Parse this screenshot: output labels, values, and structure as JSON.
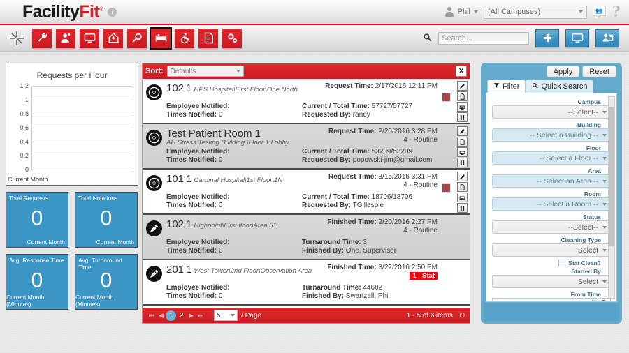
{
  "header": {
    "logo_part1": "Facility",
    "logo_part2": "Fit",
    "logo_tm": "®",
    "info_icon": "info-icon",
    "user_name": "Phil",
    "campus_value": "(All Campuses)",
    "chat_icon": "chat-users-icon",
    "help_icon": "question-mark-icon"
  },
  "toolbar": {
    "sparkle_icon": "sparkle-icon",
    "icons": [
      {
        "name": "wrench-icon",
        "label": "Maintenance"
      },
      {
        "name": "person-icon",
        "label": "Staff"
      },
      {
        "name": "monitor-icon",
        "label": "Display"
      },
      {
        "name": "home-icon",
        "label": "Home"
      },
      {
        "name": "magnifier-icon",
        "label": "Search"
      },
      {
        "name": "bed-icon",
        "label": "Beds",
        "active": true
      },
      {
        "name": "wheelchair-icon",
        "label": "Transport"
      },
      {
        "name": "document-icon",
        "label": "Reports"
      },
      {
        "name": "gears-icon",
        "label": "Settings"
      }
    ],
    "search_placeholder": "Search...",
    "add_icon": "plus-icon",
    "monitor_btn_icon": "monitor-icon",
    "user_btn_icon": "user-card-icon"
  },
  "chart_data": {
    "type": "bar",
    "title": "Requests per Hour",
    "categories": [],
    "values": [],
    "xlabel": "Current Month",
    "ylabel": "",
    "ylim": [
      0,
      1.2
    ],
    "yticks": [
      "1.2",
      "1",
      "0.8",
      "0.6",
      "0.4",
      "0.2",
      "0"
    ],
    "grid": true,
    "legend": "none",
    "note": "empty plot - no data series rendered"
  },
  "tiles": [
    {
      "title": "Total Requests",
      "value": "0",
      "footer": "Current Month"
    },
    {
      "title": "Total Isolations",
      "value": "0",
      "footer": "Current Month"
    },
    {
      "title": "Avg. Response Time",
      "value": "0",
      "footer": "Current Month (Minutes)"
    },
    {
      "title": "Avg. Turnaround Time",
      "value": "0",
      "footer": "Current Month (Minutes)"
    }
  ],
  "list": {
    "sort_label": "Sort:",
    "sort_value": "Defaults",
    "export_icon": "export-excel-icon",
    "labels": {
      "employee_notified": "Employee Notified:",
      "times_notified": "Times Notified:",
      "request_time": "Request Time:",
      "finished_time": "Finished Time:",
      "current_total_time": "Current / Total Time:",
      "requested_by": "Requested By:",
      "turnaround_time": "Turnaround Time:",
      "finished_by": "Finished By:"
    },
    "actions": [
      "edit-pencil-icon",
      "copy-page-icon",
      "print-icon",
      "pause-icon"
    ],
    "rows": [
      {
        "icon": "radiation-icon",
        "room": "102",
        "bed": "1",
        "location": "HPS Hospital\\First Floor\\One North",
        "big_title": false,
        "time_label": "Request Time:",
        "time_value": "2/17/2016 12:11 PM",
        "priority": "",
        "has_swatch": true,
        "stat": false,
        "employee_notified": "",
        "times_notified": "0",
        "metric_label": "Current / Total Time:",
        "metric_value": "57727/57727",
        "person_label": "Requested By:",
        "person_value": "randy",
        "shaded": false
      },
      {
        "icon": "radiation-icon",
        "room": "Test Patient Room 1",
        "bed": "",
        "location": "AH Stress Testing Building \\Floor 1\\Lobby",
        "big_title": true,
        "time_label": "Request Time:",
        "time_value": "2/20/2016 3:28 PM",
        "priority": "4 - Routine",
        "has_swatch": false,
        "stat": false,
        "employee_notified": "",
        "times_notified": "0",
        "metric_label": "Current / Total Time:",
        "metric_value": "53209/53209",
        "person_label": "Requested By:",
        "person_value": "popowski-jim@gmail.com",
        "shaded": true
      },
      {
        "icon": "radiation-icon",
        "room": "101",
        "bed": "1",
        "location": "Cardinal Hospital\\1st Floor\\1N",
        "big_title": false,
        "time_label": "Request Time:",
        "time_value": "3/15/2016 3:31 PM",
        "priority": "4 - Routine",
        "has_swatch": true,
        "stat": false,
        "employee_notified": "",
        "times_notified": "0",
        "metric_label": "Current / Total Time:",
        "metric_value": "18706/18706",
        "person_label": "Requested By:",
        "person_value": "TGillespie",
        "shaded": false
      },
      {
        "icon": "cleaning-brush-icon",
        "room": "102",
        "bed": "1",
        "location": "Highpoint\\First floor\\Area 51",
        "big_title": false,
        "time_label": "Finished Time:",
        "time_value": "2/20/2016 2:27 PM",
        "priority": "4 - Routine",
        "has_swatch": false,
        "stat": false,
        "employee_notified": "",
        "times_notified": "0",
        "metric_label": "Turnaround Time:",
        "metric_value": "3",
        "person_label": "Finished By:",
        "person_value": "One, Supervisor",
        "shaded": true
      },
      {
        "icon": "cleaning-brush-icon",
        "room": "201",
        "bed": "1",
        "location": "West Tower\\2nd Floor\\Observation Area",
        "big_title": false,
        "time_label": "Finished Time:",
        "time_value": "3/22/2016 2:50 PM",
        "priority": "1 - Stat",
        "has_swatch": false,
        "stat": true,
        "employee_notified": "",
        "times_notified": "0",
        "metric_label": "Turnaround Time:",
        "metric_value": "44602",
        "person_label": "Finished By:",
        "person_value": "Swartzell, Phil",
        "shaded": false
      }
    ],
    "footer": {
      "first_icon": "first-page-icon",
      "prev_icon": "prev-page-icon",
      "pages": [
        "1",
        "2"
      ],
      "current_page": "1",
      "next_icon": "next-page-icon",
      "last_icon": "last-page-icon",
      "page_size": "5",
      "per_page_label": "/ Page",
      "items_text": "1 - 5 of 6 items",
      "refresh_icon": "refresh-icon"
    }
  },
  "filter": {
    "apply_label": "Apply",
    "reset_label": "Reset",
    "tabs": [
      {
        "label": "Filter",
        "icon": "funnel-icon",
        "active": true
      },
      {
        "label": "Quick Search",
        "icon": "magnifier-icon",
        "active": false
      }
    ],
    "fields": [
      {
        "label": "Campus",
        "value": "--Select--",
        "style": "gray"
      },
      {
        "label": "Building",
        "value": "-- Select a Building --",
        "style": "blue"
      },
      {
        "label": "Floor",
        "value": "-- Select a Floor --",
        "style": "blue"
      },
      {
        "label": "Area",
        "value": "-- Select an Area --",
        "style": "blue"
      },
      {
        "label": "Room",
        "value": "-- Select a Room --",
        "style": "blue"
      },
      {
        "label": "Status",
        "value": "--Select--",
        "style": "gray"
      },
      {
        "label": "Cleaning Type",
        "value": "Select",
        "style": "gray"
      }
    ],
    "checkbox": {
      "label": "Stat Clean?",
      "checked": false
    },
    "started_by": {
      "label": "Started By",
      "value": "Select"
    },
    "from_time": {
      "label": "From Time",
      "calendar_icon": "calendar-icon",
      "clock_icon": "clock-icon"
    }
  },
  "colors": {
    "brand_red": "#cc1b21",
    "accent_blue": "#3b96c6",
    "panel_blue": "#64aacd",
    "stat_red": "#fb0007",
    "priority_swatch": "#a8464a"
  }
}
